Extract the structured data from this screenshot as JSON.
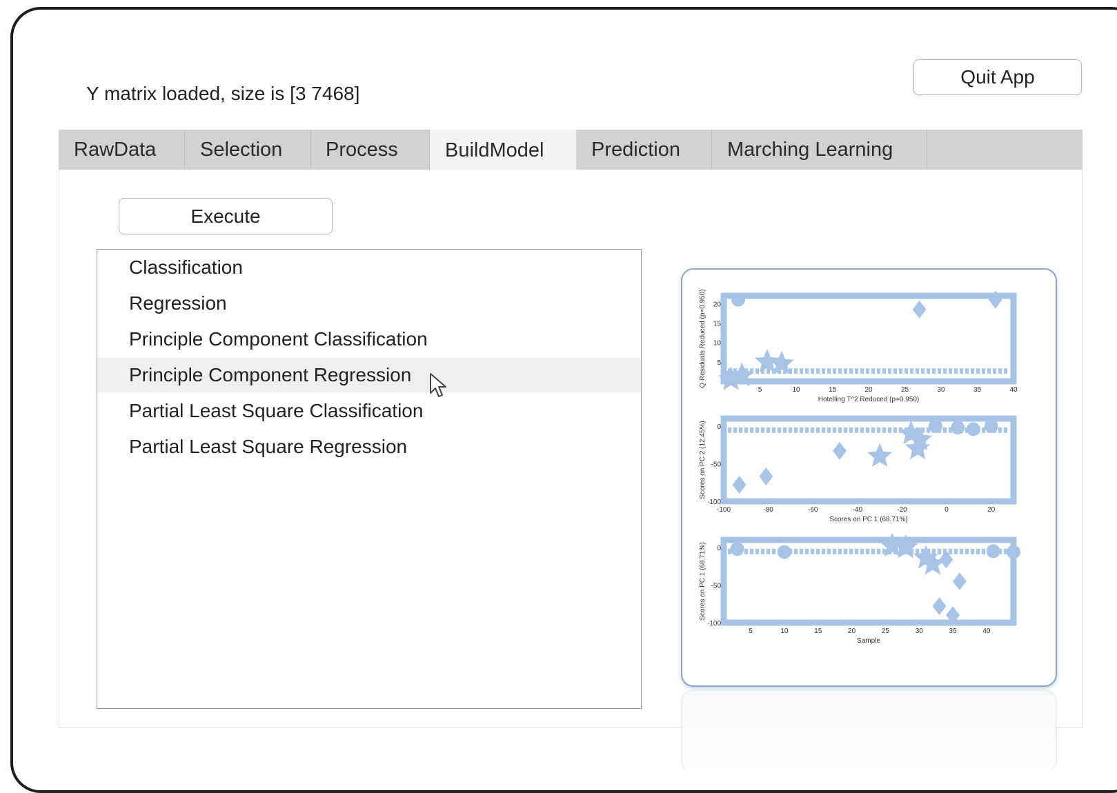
{
  "status_text": "Y matrix loaded, size is [3 7468]",
  "quit_label": "Quit App",
  "tabs": [
    {
      "label": "RawData"
    },
    {
      "label": "Selection"
    },
    {
      "label": "Process"
    },
    {
      "label": "BuildModel",
      "active": true
    },
    {
      "label": "Prediction"
    },
    {
      "label": "Marching Learning"
    }
  ],
  "execute_label": "Execute",
  "methods": [
    "Classification",
    "Regression",
    "Principle Component Classification",
    "Principle Component Regression",
    "Partial Least Square Classification",
    "Partial Least Square Regression"
  ],
  "hovered_method_index": 3,
  "plot_color": "#a7c4e6",
  "chart_data": [
    {
      "type": "scatter",
      "xlabel": "Hotelling T^2 Reduced (p=0.950)",
      "ylabel": "Q Residuals Reduced (p=0.950)",
      "xticks": [
        "5",
        "10",
        "15",
        "20",
        "25",
        "30",
        "35",
        "40"
      ],
      "yticks": [
        "5",
        "10",
        "15",
        "20"
      ],
      "xlim": [
        0,
        40
      ],
      "ylim": [
        0,
        22
      ],
      "points": [
        {
          "x": 27,
          "y": 18.5,
          "marker": "diamond"
        },
        {
          "x": 37.5,
          "y": 21,
          "marker": "diamond"
        },
        {
          "x": 6,
          "y": 5,
          "marker": "star"
        },
        {
          "x": 8,
          "y": 4.5,
          "marker": "star"
        },
        {
          "x": 2.5,
          "y": 1.5,
          "marker": "star"
        },
        {
          "x": 1,
          "y": 0.5,
          "marker": "star"
        },
        {
          "x": 0.8,
          "y": 1,
          "marker": "circle"
        },
        {
          "x": 2,
          "y": 21,
          "marker": "circle"
        }
      ]
    },
    {
      "type": "scatter",
      "xlabel": "Scores on PC 1 (68.71%)",
      "ylabel": "Scores on PC 2 (12.45%)",
      "xticks": [
        "-100",
        "-80",
        "-60",
        "-40",
        "-20",
        "0",
        "20"
      ],
      "yticks": [
        "0",
        "-50",
        "-100"
      ],
      "xlim": [
        -100,
        30
      ],
      "ylim": [
        -100,
        10
      ],
      "points": [
        {
          "x": -93,
          "y": -78,
          "marker": "diamond"
        },
        {
          "x": -81,
          "y": -67,
          "marker": "diamond"
        },
        {
          "x": -48,
          "y": -33,
          "marker": "diamond"
        },
        {
          "x": -30,
          "y": -40,
          "marker": "star"
        },
        {
          "x": -13,
          "y": -30,
          "marker": "star"
        },
        {
          "x": -12,
          "y": -18,
          "marker": "star"
        },
        {
          "x": -16,
          "y": -10,
          "marker": "star"
        },
        {
          "x": -5,
          "y": 0,
          "marker": "circle"
        },
        {
          "x": 5,
          "y": -2,
          "marker": "circle"
        },
        {
          "x": 12,
          "y": -4,
          "marker": "circle"
        },
        {
          "x": 20,
          "y": 0,
          "marker": "circle"
        }
      ]
    },
    {
      "type": "scatter",
      "xlabel": "Sample",
      "ylabel": "Scores on PC 1 (68.71%)",
      "xticks": [
        "5",
        "10",
        "15",
        "20",
        "25",
        "30",
        "35",
        "40"
      ],
      "yticks": [
        "0",
        "-50",
        "-100"
      ],
      "xlim": [
        1,
        44
      ],
      "ylim": [
        -100,
        10
      ],
      "points": [
        {
          "x": 33,
          "y": -78,
          "marker": "diamond"
        },
        {
          "x": 35,
          "y": -90,
          "marker": "diamond"
        },
        {
          "x": 36,
          "y": -45,
          "marker": "diamond"
        },
        {
          "x": 34,
          "y": -16,
          "marker": "diamond"
        },
        {
          "x": 31,
          "y": -14,
          "marker": "star"
        },
        {
          "x": 32,
          "y": -22,
          "marker": "star"
        },
        {
          "x": 26,
          "y": 2,
          "marker": "star"
        },
        {
          "x": 28,
          "y": 0,
          "marker": "star"
        },
        {
          "x": 41,
          "y": -5,
          "marker": "circle"
        },
        {
          "x": 44,
          "y": -6,
          "marker": "circle"
        },
        {
          "x": 10,
          "y": -6,
          "marker": "circle"
        },
        {
          "x": 3,
          "y": -2,
          "marker": "circle"
        }
      ]
    }
  ]
}
